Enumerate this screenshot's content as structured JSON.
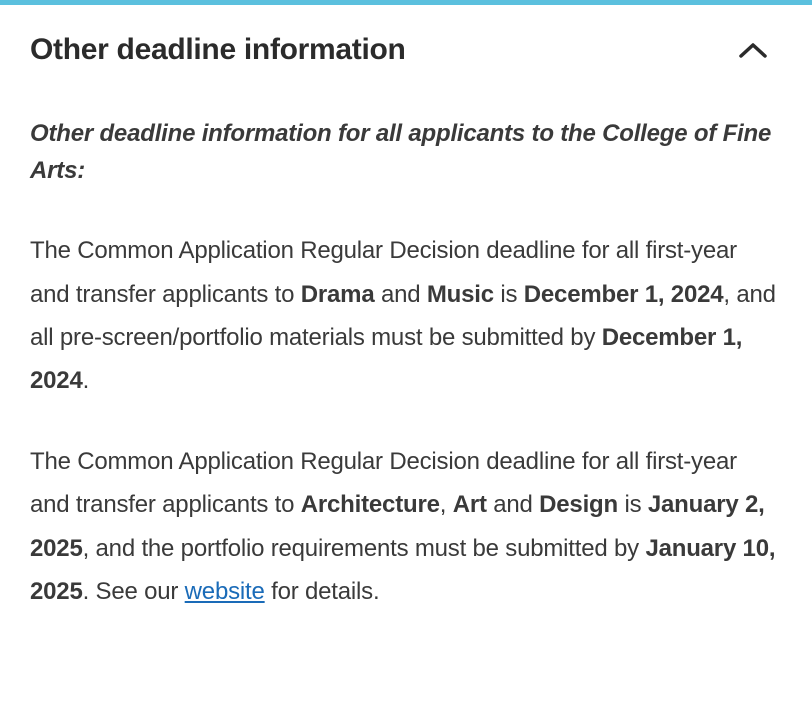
{
  "accordion": {
    "title": "Other deadline information"
  },
  "content": {
    "intro": "Other deadline information for all applicants to the College of Fine Arts:",
    "p1": {
      "pre1": "The Common Application Regular Decision deadline for all first-year and transfer applicants to ",
      "major1": "Drama",
      "and": " and ",
      "major2": "Music",
      "mid1": " is ",
      "date1": "December 1, 2024",
      "mid2": ", and all pre-screen/portfolio materials must be submitted by ",
      "date2": "December 1, 2024",
      "post": "."
    },
    "p2": {
      "pre1": "The Common Application Regular Decision deadline for all first-year and transfer applicants to ",
      "major1": "Architecture",
      "sep1": ", ",
      "major2": "Art",
      "sep2": " and ",
      "major3": "Design",
      "mid1": " is ",
      "date1": "January 2, 2025",
      "mid2": ", and the portfolio requirements must be submitted by ",
      "date2": "January 10, 2025",
      "post1": ".  See our ",
      "link": "website",
      "post2": " for details."
    }
  }
}
